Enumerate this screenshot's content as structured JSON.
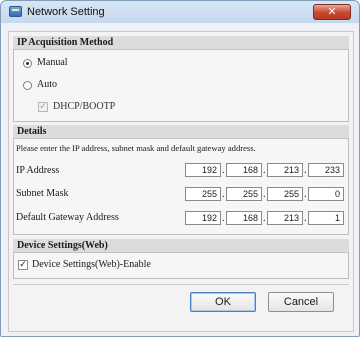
{
  "window": {
    "title": "Network Setting",
    "close_glyph": "✕",
    "title_icon": "network-app-icon"
  },
  "ip_method": {
    "header": "IP Acquisition Method",
    "manual_label": "Manual",
    "auto_label": "Auto",
    "dhcp_label": "DHCP/BOOTP",
    "selected": "Manual",
    "dhcp_checked": true,
    "dhcp_enabled": false
  },
  "details": {
    "header": "Details",
    "instruction": "Please enter the IP address, subnet mask and default gateway address.",
    "rows": [
      {
        "label": "IP Address",
        "octets": [
          "192",
          "168",
          "213",
          "233"
        ]
      },
      {
        "label": "Subnet Mask",
        "octets": [
          "255",
          "255",
          "255",
          "0"
        ]
      },
      {
        "label": "Default Gateway Address",
        "octets": [
          "192",
          "168",
          "213",
          "1"
        ]
      }
    ],
    "separator": "."
  },
  "device_settings": {
    "header": "Device Settings(Web)",
    "enable_label": "Device Settings(Web)-Enable",
    "enable_checked": true
  },
  "buttons": {
    "ok_label": "OK",
    "cancel_label": "Cancel"
  },
  "check_glyph": "✓"
}
